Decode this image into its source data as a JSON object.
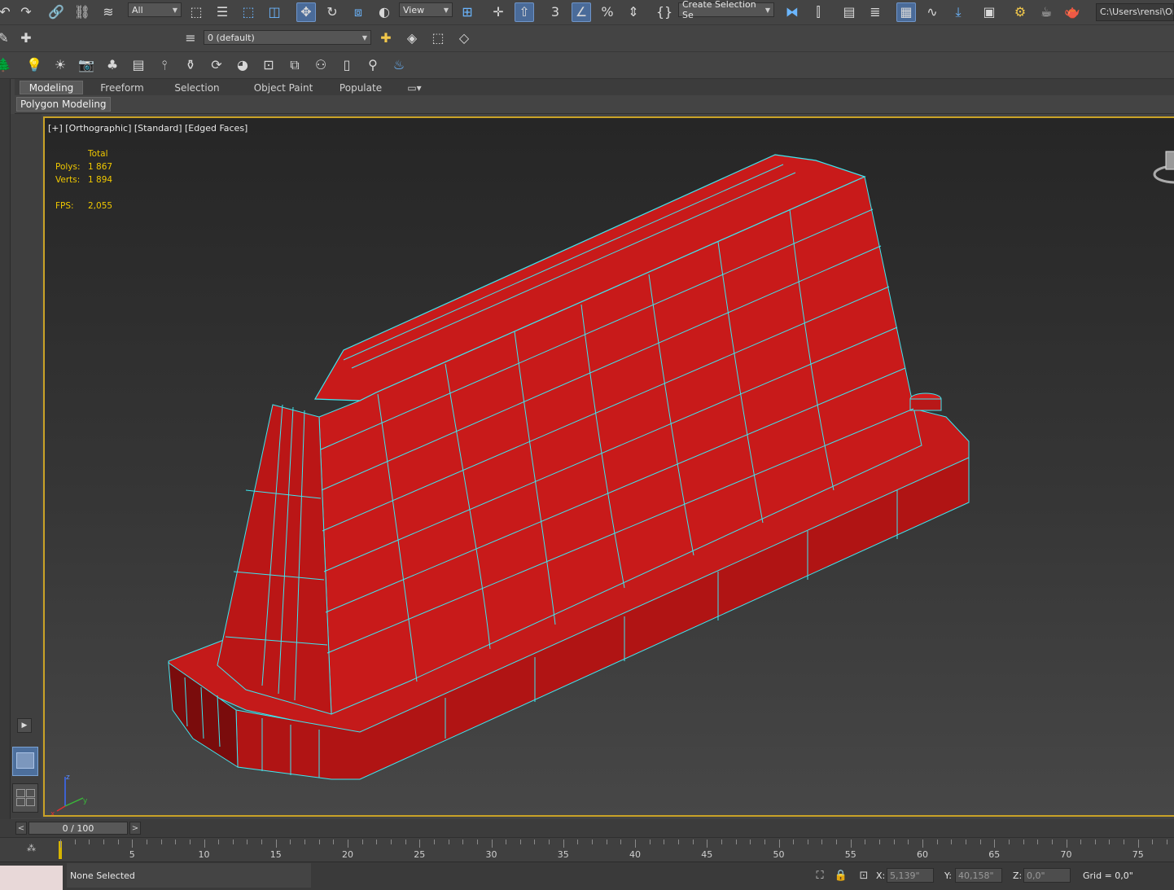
{
  "toolbar": {
    "selection_filter": "All",
    "ref_coord": "View",
    "named_selection": "Create Selection Se",
    "path": "C:\\Users\\rensi\\One"
  },
  "layers": {
    "current_layer": "0 (default)"
  },
  "ribbon": {
    "tabs": [
      "Modeling",
      "Freeform",
      "Selection",
      "Object Paint",
      "Populate"
    ],
    "active_panel": "Polygon Modeling"
  },
  "viewport": {
    "label": "[+] [Orthographic] [Standard] [Edged Faces]",
    "stats": {
      "header": "Total",
      "polys_label": "Polys:",
      "polys": "1 867",
      "verts_label": "Verts:",
      "verts": "1 894",
      "fps_label": "FPS:",
      "fps": "2,055"
    },
    "axis": {
      "x": "x",
      "y": "y",
      "z": "z"
    },
    "colors": {
      "mesh": "#c4161c",
      "wire": "#39e6f0",
      "border": "#c9a227"
    }
  },
  "timeline": {
    "frame": "0 / 100",
    "ticks": [
      "5",
      "10",
      "15",
      "20",
      "25",
      "30",
      "35",
      "40",
      "45",
      "50",
      "55",
      "60",
      "65",
      "70",
      "75"
    ]
  },
  "status": {
    "selection": "None Selected",
    "x_label": "X:",
    "x": "5,139\"",
    "y_label": "Y:",
    "y": "40,158\"",
    "z_label": "Z:",
    "z": "0,0\"",
    "grid": "Grid = 0,0\""
  }
}
